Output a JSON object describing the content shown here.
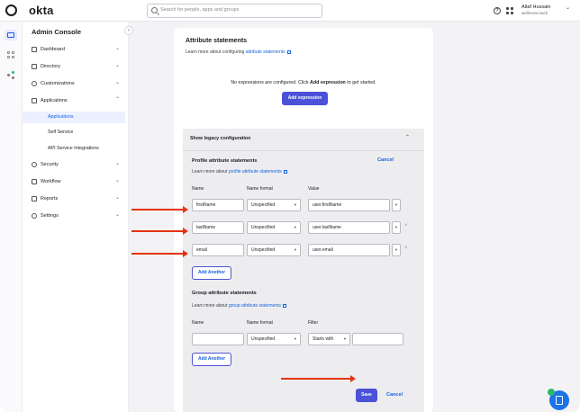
{
  "app": {
    "brand": "okta",
    "search_placeholder": "Search for people, apps and groups",
    "help_glyph": "?",
    "user_name": "Altaf Hussain",
    "user_org": "wellnesscoach"
  },
  "sidebar": {
    "title": "Admin Console",
    "collapse_glyph": "‹",
    "items": [
      {
        "label": "Dashboard",
        "icon": "home-icon",
        "chevron": "⌄"
      },
      {
        "label": "Directory",
        "icon": "directory-icon",
        "chevron": "⌄"
      },
      {
        "label": "Customizations",
        "icon": "customizations-icon",
        "chevron": "⌄"
      },
      {
        "label": "Applications",
        "icon": "applications-icon",
        "chevron": "⌃"
      },
      {
        "label": "Security",
        "icon": "shield-icon",
        "chevron": "⌄"
      },
      {
        "label": "Workflow",
        "icon": "workflow-icon",
        "chevron": "⌄"
      },
      {
        "label": "Reports",
        "icon": "reports-icon",
        "chevron": "⌄"
      },
      {
        "label": "Settings",
        "icon": "gear-icon",
        "chevron": "⌄"
      }
    ],
    "subitems": [
      "Applications",
      "Self Service",
      "API Service Integrations"
    ]
  },
  "attributes": {
    "title": "Attribute statements",
    "learn_prefix": "Learn more about configuring ",
    "learn_link": "attribute statements",
    "empty_prefix": "No expressions are configured. Click ",
    "empty_bold": "Add expression",
    "empty_suffix": " to get started.",
    "add_expression": "Add expression"
  },
  "legacy": {
    "header": "Show legacy configuration",
    "chevron": "⌃",
    "profile": {
      "title": "Profile attribute statements",
      "cancel": "Cancel",
      "learn_prefix": "Learn more about ",
      "learn_link": "profile attribute statements",
      "col_name": "Name",
      "col_format": "Name format",
      "col_value": "Value",
      "rows": [
        {
          "name": "firstName",
          "format": "Unspecified",
          "value": "user.firstName"
        },
        {
          "name": "lastName",
          "format": "Unspecified",
          "value": "user.lastName"
        },
        {
          "name": "email",
          "format": "Unspecified",
          "value": "user.email"
        }
      ],
      "add_another": "Add Another"
    },
    "group": {
      "title": "Group attribute statements",
      "learn_prefix": "Learn more about ",
      "learn_link": "group attribute statements",
      "col_name": "Name",
      "col_format": "Name format",
      "col_filter": "Filter",
      "row": {
        "name": "",
        "format": "Unspecified",
        "filter_type": "Starts with",
        "filter_value": ""
      },
      "add_another": "Add Another"
    },
    "save": "Save",
    "cancel": "Cancel"
  },
  "icons": {
    "dropdown": "▾",
    "remove": "×"
  },
  "colors": {
    "accent": "#4b52d8",
    "link": "#1662dd",
    "annotation_arrow": "#e53312"
  }
}
